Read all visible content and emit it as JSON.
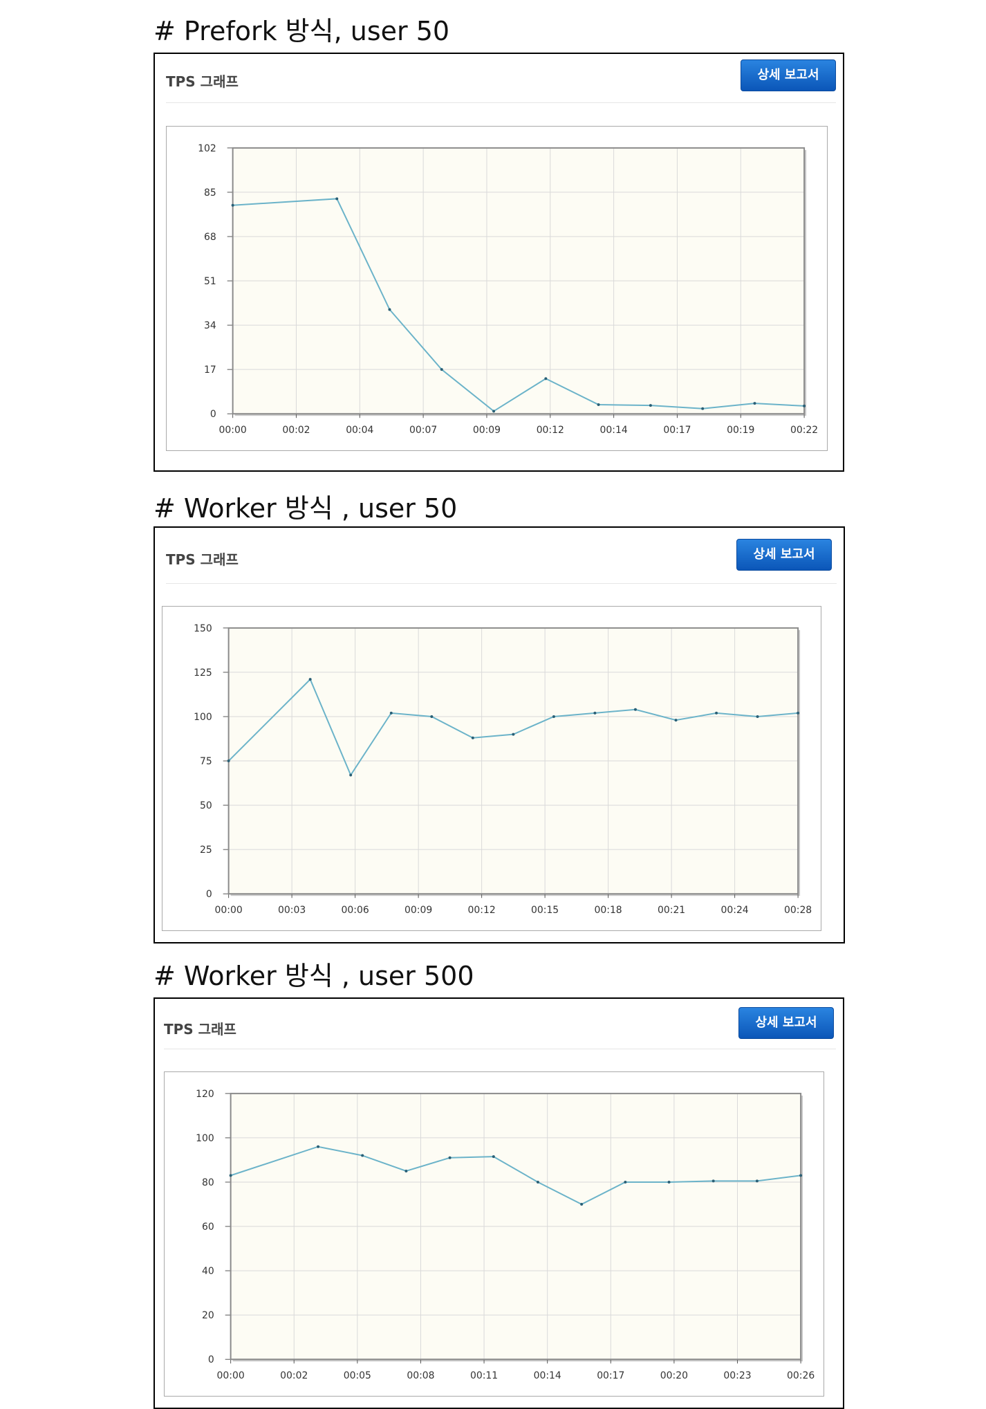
{
  "charts": [
    {
      "heading": "# Prefork 방식, user 50",
      "panel_title": "TPS 그래프",
      "button_label": "상세 보고서",
      "chart_data": {
        "type": "line",
        "title": "",
        "xlabel": "",
        "ylabel": "",
        "ylim": [
          0,
          102
        ],
        "yticks": [
          "0",
          "17",
          "34",
          "51",
          "68",
          "85",
          "102"
        ],
        "xticks": [
          "00:00",
          "00:02",
          "00:04",
          "00:07",
          "00:09",
          "00:12",
          "00:14",
          "00:17",
          "00:19",
          "00:22"
        ],
        "grid": true,
        "line_color": "#6bb3c9",
        "plot_bg": "#fdfcf4",
        "series": [
          {
            "x": [
              0,
              1.64,
              2.47,
              3.29,
              4.11,
              4.93,
              5.76,
              6.58,
              7.4,
              8.22,
              9
            ],
            "values": [
              80,
              82.5,
              40,
              17,
              1,
              13.5,
              3.5,
              3.2,
              2,
              4,
              3
            ]
          }
        ]
      }
    },
    {
      "heading": "# Worker 방식 , user 50",
      "panel_title": "TPS 그래프",
      "button_label": "상세 보고서",
      "chart_data": {
        "type": "line",
        "title": "",
        "xlabel": "",
        "ylabel": "",
        "ylim": [
          0,
          150
        ],
        "yticks": [
          "0",
          "25",
          "50",
          "75",
          "100",
          "125",
          "150"
        ],
        "xticks": [
          "00:00",
          "00:03",
          "00:06",
          "00:09",
          "00:12",
          "00:15",
          "00:18",
          "00:21",
          "00:24",
          "00:28"
        ],
        "grid": true,
        "line_color": "#6bb3c9",
        "plot_bg": "#fdfcf4",
        "series": [
          {
            "x": [
              0,
              1.29,
              1.93,
              2.57,
              3.21,
              3.86,
              4.5,
              5.14,
              5.79,
              6.43,
              7.07,
              7.71,
              8.36,
              9
            ],
            "values": [
              75,
              121,
              67,
              102,
              100,
              88,
              90,
              100,
              102,
              104,
              98,
              102,
              100,
              102
            ]
          }
        ]
      }
    },
    {
      "heading": "# Worker 방식 , user 500",
      "panel_title": "TPS 그래프",
      "button_label": "상세 보고서",
      "chart_data": {
        "type": "line",
        "title": "",
        "xlabel": "",
        "ylabel": "",
        "ylim": [
          0,
          120
        ],
        "yticks": [
          "0",
          "20",
          "40",
          "60",
          "80",
          "100",
          "120"
        ],
        "xticks": [
          "00:00",
          "00:02",
          "00:05",
          "00:08",
          "00:11",
          "00:14",
          "00:17",
          "00:20",
          "00:23",
          "00:26"
        ],
        "grid": true,
        "line_color": "#6bb3c9",
        "plot_bg": "#fdfcf4",
        "series": [
          {
            "x": [
              0,
              1.38,
              2.08,
              2.77,
              3.46,
              4.15,
              4.85,
              5.54,
              6.23,
              6.92,
              7.62,
              8.31,
              9
            ],
            "values": [
              83,
              96,
              92,
              85,
              91,
              91.5,
              80,
              70,
              80,
              80,
              80.5,
              80.5,
              83
            ]
          }
        ]
      }
    }
  ]
}
